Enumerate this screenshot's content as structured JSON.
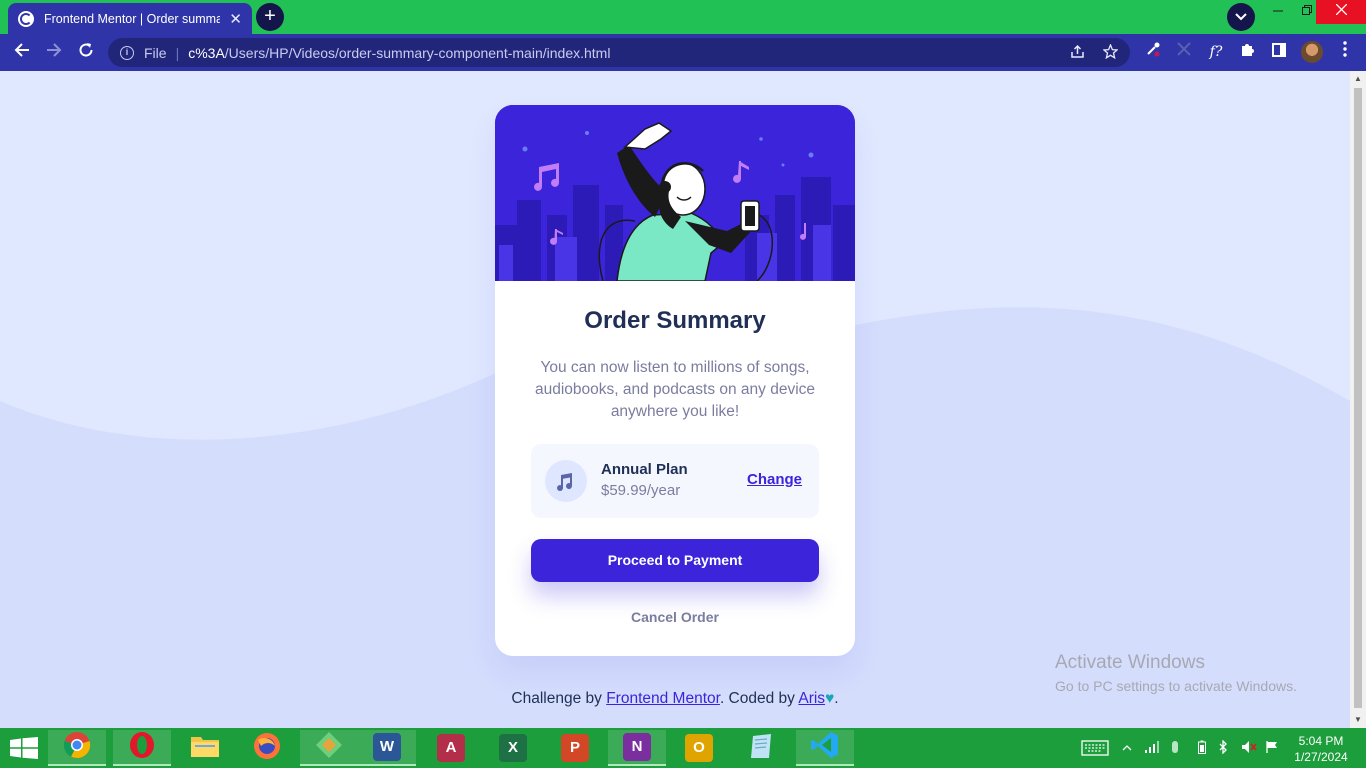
{
  "browser": {
    "tab_title": "Frontend Mentor | Order summary",
    "new_tab_symbol": "+",
    "tab_close_symbol": "✕",
    "url_scheme": "File",
    "url_host": "c%3A",
    "url_path": "/Users/HP/Videos/order-summary-component-main/index.html"
  },
  "page": {
    "title": "Order Summary",
    "description": "You can now listen to millions of songs, audiobooks, and podcasts on any device anywhere you like!",
    "plan_name": "Annual Plan",
    "plan_price": "$59.99/year",
    "change_label": "Change",
    "pay_label": "Proceed to Payment",
    "cancel_label": "Cancel Order",
    "attribution_prefix": "Challenge by ",
    "attribution_link": "Frontend Mentor",
    "attribution_mid": ". Coded by ",
    "author_link": "Aris",
    "attribution_suffix": ".",
    "heart_symbol": "♥"
  },
  "watermark": {
    "title": "Activate Windows",
    "subtitle": "Go to PC settings to activate Windows."
  },
  "taskbar": {
    "time": "5:04 PM",
    "date": "1/27/2024",
    "apps": [
      {
        "name": "chrome-app",
        "icon": "chrome-icon",
        "active": true
      },
      {
        "name": "opera-app",
        "icon": "opera-icon",
        "active": true
      },
      {
        "name": "file-explorer-app",
        "icon": "folder-icon",
        "active": false
      },
      {
        "name": "firefox-app",
        "icon": "firefox-icon",
        "active": false
      },
      {
        "name": "mapping-app",
        "icon": "map-app-icon",
        "active": false
      },
      {
        "name": "word-app",
        "icon": "word-icon",
        "active": true
      },
      {
        "name": "access-app",
        "icon": "access-icon",
        "active": false
      },
      {
        "name": "excel-app",
        "icon": "excel-icon",
        "active": false
      },
      {
        "name": "powerpoint-app",
        "icon": "powerpoint-icon",
        "active": false
      },
      {
        "name": "onenote-app",
        "icon": "onenote-icon",
        "active": true
      },
      {
        "name": "outlook-app",
        "icon": "outlook-icon",
        "active": false
      },
      {
        "name": "notes-app",
        "icon": "notes-icon",
        "active": false
      },
      {
        "name": "vscode-app",
        "icon": "vscode-icon",
        "active": true
      }
    ]
  },
  "colors": {
    "accent": "#3b24da",
    "page_bg": "#e0e8ff",
    "title_text": "#1f2f56",
    "muted_text": "#7a7d9f",
    "browser_chrome": "#2f35a8",
    "titlebar": "#22c156",
    "taskbar": "#1c9e3c"
  }
}
